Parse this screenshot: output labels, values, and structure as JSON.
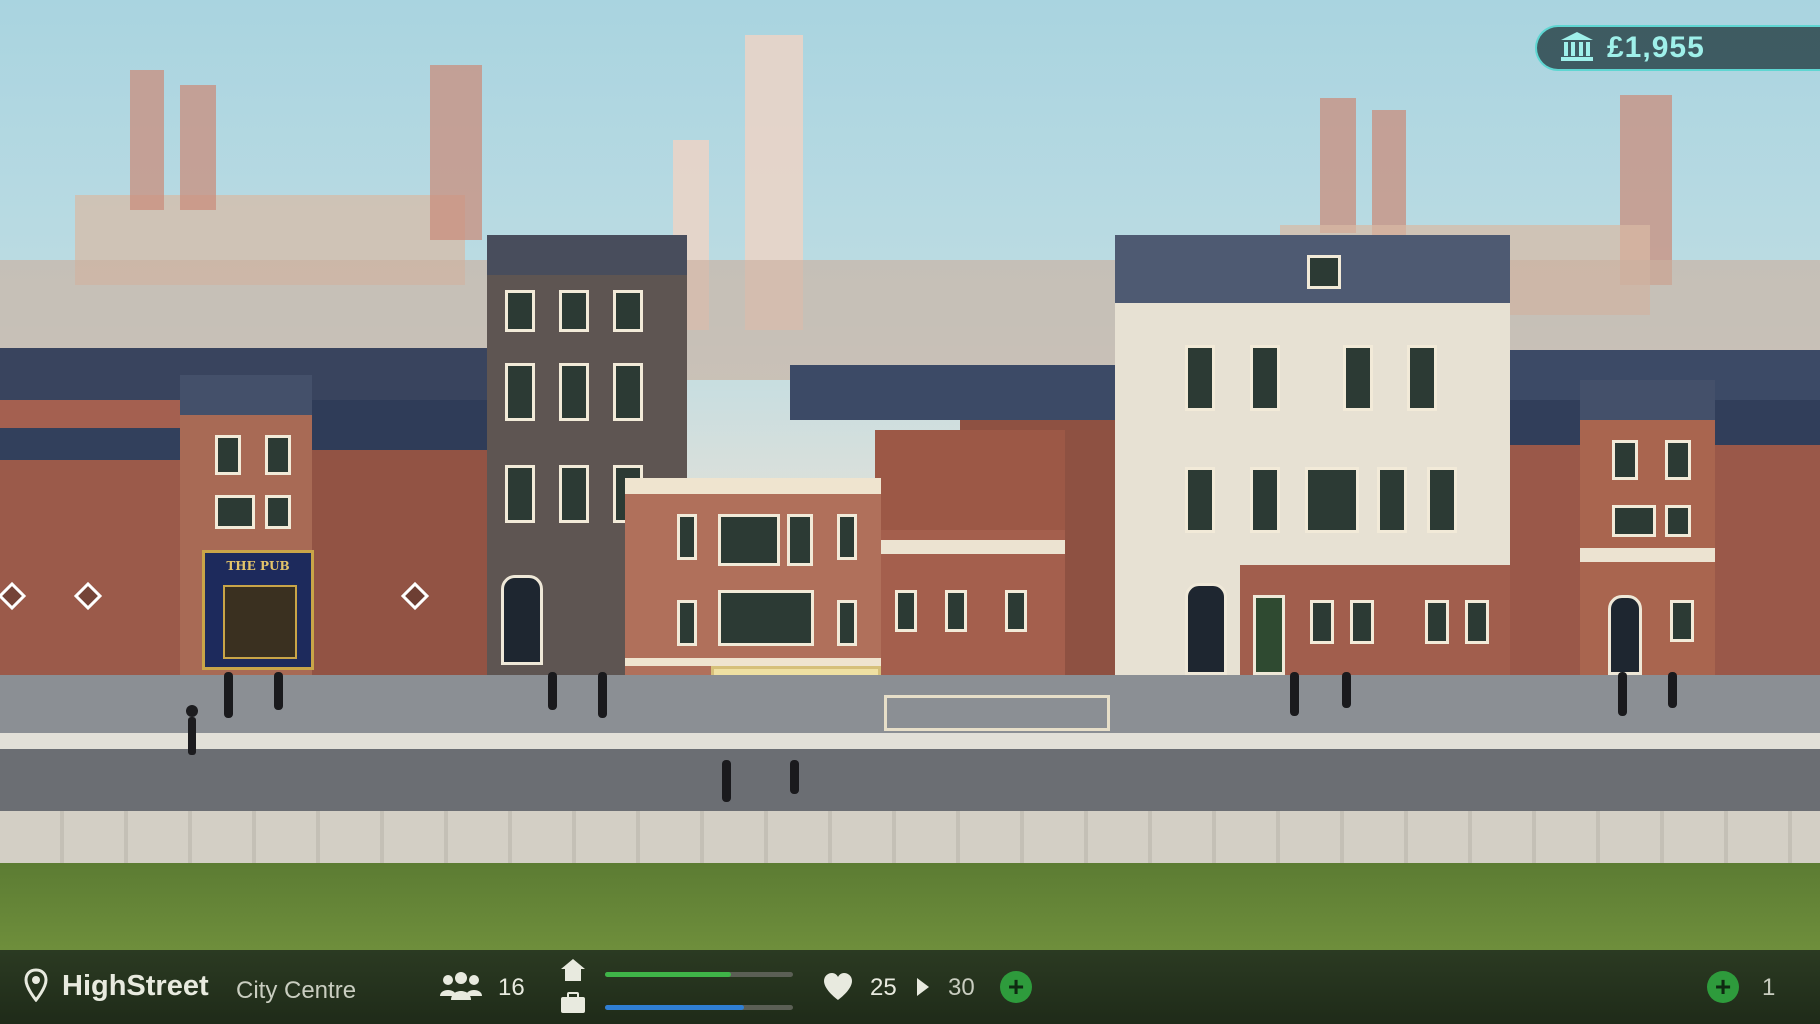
{
  "bank": {
    "icon": "bank-icon",
    "amount": "£1,955"
  },
  "location": {
    "icon": "map-pin-icon",
    "street": "HighStreet",
    "area": "City Centre"
  },
  "population": {
    "icon": "people-icon",
    "value": "16"
  },
  "housing": {
    "icon": "house-icon",
    "fill": 0.67,
    "color": "#3fb548"
  },
  "jobs": {
    "icon": "briefcase-icon",
    "fill": 0.74,
    "color": "#2f7fd4"
  },
  "happiness": {
    "icon": "heart-icon",
    "current": "25",
    "arrow_icon": "play-arrow-icon",
    "target": "30"
  },
  "action_plus": {
    "icon": "plus-icon"
  },
  "bonus": {
    "icon": "plus-icon",
    "count": "1"
  },
  "pub_sign": "THE PUB",
  "colors": {
    "accent": "#5fd6d2",
    "plus": "#2e9b3c"
  }
}
